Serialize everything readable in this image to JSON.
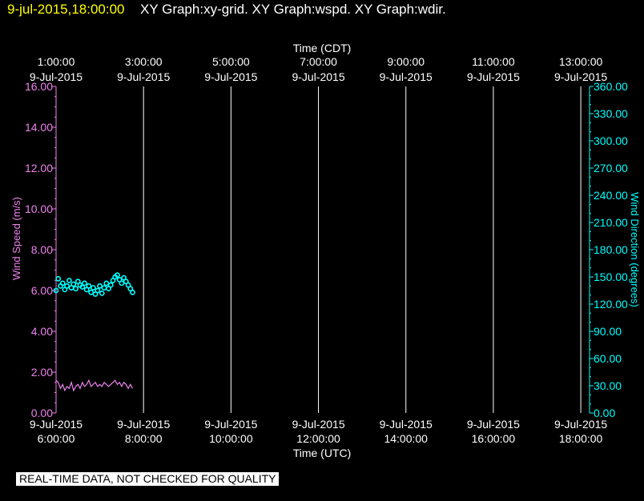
{
  "header": {
    "timestamp": "9-jul-2015,18:00:00",
    "graphs": "XY Graph:xy-grid.  XY Graph:wspd.  XY Graph:wdir."
  },
  "notice": "REAL-TIME DATA, NOT CHECKED FOR QUALITY",
  "colors": {
    "background": "#000000",
    "grid": "#ffffff",
    "wspd": "#ee82ee",
    "wdir": "#00ffff",
    "timestamp": "#ffff00"
  },
  "chart_data": {
    "type": "line",
    "x_domain_utc_hours": [
      6,
      18.2
    ],
    "top_axis": {
      "title": "Time (CDT)",
      "ticks": [
        {
          "h": 6,
          "time": "1:00:00",
          "date": "9-Jul-2015"
        },
        {
          "h": 8,
          "time": "3:00:00",
          "date": "9-Jul-2015"
        },
        {
          "h": 10,
          "time": "5:00:00",
          "date": "9-Jul-2015"
        },
        {
          "h": 12,
          "time": "7:00:00",
          "date": "9-Jul-2015"
        },
        {
          "h": 14,
          "time": "9:00:00",
          "date": "9-Jul-2015"
        },
        {
          "h": 16,
          "time": "11:00:00",
          "date": "9-Jul-2015"
        },
        {
          "h": 18,
          "time": "13:00:00",
          "date": "9-Jul-2015"
        }
      ]
    },
    "bottom_axis": {
      "title": "Time (UTC)",
      "ticks": [
        {
          "h": 6,
          "date": "9-Jul-2015",
          "time": "6:00:00"
        },
        {
          "h": 8,
          "date": "9-Jul-2015",
          "time": "8:00:00"
        },
        {
          "h": 10,
          "date": "9-Jul-2015",
          "time": "10:00:00"
        },
        {
          "h": 12,
          "date": "9-Jul-2015",
          "time": "12:00:00"
        },
        {
          "h": 14,
          "date": "9-Jul-2015",
          "time": "14:00:00"
        },
        {
          "h": 16,
          "date": "9-Jul-2015",
          "time": "16:00:00"
        },
        {
          "h": 18,
          "date": "9-Jul-2015",
          "time": "18:00:00"
        }
      ]
    },
    "left_axis": {
      "title": "Wind Speed (m/s)",
      "range": [
        0,
        16
      ],
      "ticks": [
        "0.00",
        "2.00",
        "4.00",
        "6.00",
        "8.00",
        "10.00",
        "12.00",
        "14.00",
        "16.00"
      ]
    },
    "right_axis": {
      "title": "Wind Direction (degrees)",
      "range": [
        0,
        360
      ],
      "ticks": [
        "0.00",
        "30.00",
        "60.00",
        "90.00",
        "120.00",
        "150.00",
        "180.00",
        "210.00",
        "240.00",
        "270.00",
        "300.00",
        "330.00",
        "360.00"
      ]
    },
    "grid": true,
    "series": [
      {
        "key": "wspd",
        "axis": "left",
        "style": "line",
        "x_utc_hours": [
          6.0,
          6.05,
          6.1,
          6.15,
          6.2,
          6.25,
          6.3,
          6.35,
          6.4,
          6.45,
          6.5,
          6.55,
          6.6,
          6.65,
          6.7,
          6.75,
          6.8,
          6.85,
          6.9,
          6.95,
          7.0,
          7.05,
          7.1,
          7.15,
          7.2,
          7.25,
          7.3,
          7.35,
          7.4,
          7.45,
          7.5,
          7.55,
          7.6,
          7.65,
          7.7,
          7.75
        ],
        "values": [
          1.6,
          1.5,
          1.2,
          1.4,
          1.1,
          1.3,
          1.2,
          1.5,
          1.1,
          1.3,
          1.4,
          1.2,
          1.5,
          1.3,
          1.4,
          1.6,
          1.3,
          1.4,
          1.5,
          1.3,
          1.4,
          1.3,
          1.5,
          1.4,
          1.3,
          1.4,
          1.5,
          1.6,
          1.4,
          1.5,
          1.3,
          1.5,
          1.4,
          1.2,
          1.4,
          1.2
        ]
      },
      {
        "key": "wdir",
        "axis": "right",
        "style": "circles",
        "x_utc_hours": [
          6.0,
          6.05,
          6.1,
          6.15,
          6.2,
          6.25,
          6.3,
          6.35,
          6.4,
          6.45,
          6.5,
          6.55,
          6.6,
          6.65,
          6.7,
          6.75,
          6.8,
          6.85,
          6.9,
          6.95,
          7.0,
          7.05,
          7.1,
          7.15,
          7.2,
          7.25,
          7.3,
          7.35,
          7.4,
          7.45,
          7.5,
          7.55,
          7.6,
          7.65,
          7.7,
          7.75
        ],
        "values": [
          135,
          148,
          140,
          143,
          136,
          140,
          146,
          138,
          142,
          137,
          145,
          141,
          139,
          143,
          136,
          140,
          133,
          138,
          131,
          135,
          140,
          132,
          138,
          143,
          137,
          141,
          146,
          150,
          152,
          147,
          143,
          149,
          145,
          141,
          137,
          133
        ]
      }
    ]
  }
}
